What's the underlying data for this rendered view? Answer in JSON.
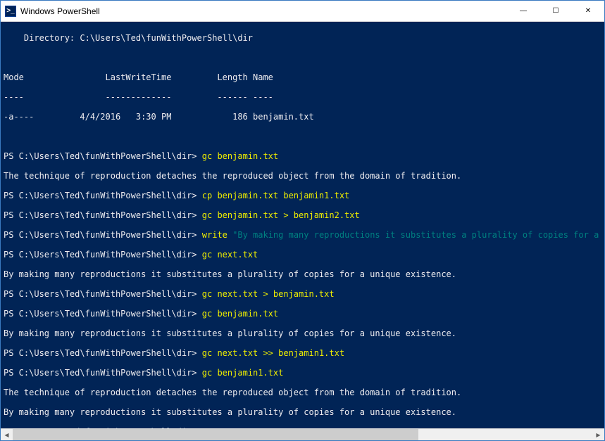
{
  "window": {
    "title": "Windows PowerShell",
    "icon_label": ">_",
    "minimize_glyph": "—",
    "maximize_glyph": "☐",
    "close_glyph": "✕"
  },
  "terminal": {
    "directory_label": "    Directory: C:\\Users\\Ted\\funWithPowerShell\\dir",
    "blank": "",
    "header": {
      "mode": "Mode",
      "lastwrite": "LastWriteTime",
      "length": "Length",
      "name": "Name"
    },
    "header_row": "Mode                LastWriteTime         Length Name",
    "header_sep": "----                -------------         ------ ----",
    "listing_row": "-a----         4/4/2016   3:30 PM            186 benjamin.txt",
    "prompt": "PS C:\\Users\\Ted\\funWithPowerShell\\dir> ",
    "cmds": {
      "c1": "gc benjamin.txt",
      "c2": "cp benjamin.txt benjamin1.txt",
      "c3": "gc benjamin.txt > benjamin2.txt",
      "c4_cmd": "write ",
      "c4_arg": "\"By making many reproductions it substitutes a plurality of copies for a un",
      "c5": "gc next.txt",
      "c6": "gc next.txt > benjamin.txt",
      "c7": "gc benjamin.txt",
      "c8": "gc next.txt >> benjamin1.txt",
      "c9": "gc benjamin1.txt"
    },
    "out": {
      "tradition": "The technique of reproduction detaches the reproduced object from the domain of tradition.",
      "copies": "By making many reproductions it substitutes a plurality of copies for a unique existence."
    }
  },
  "scrollbar": {
    "left_glyph": "◀",
    "right_glyph": "▶"
  }
}
